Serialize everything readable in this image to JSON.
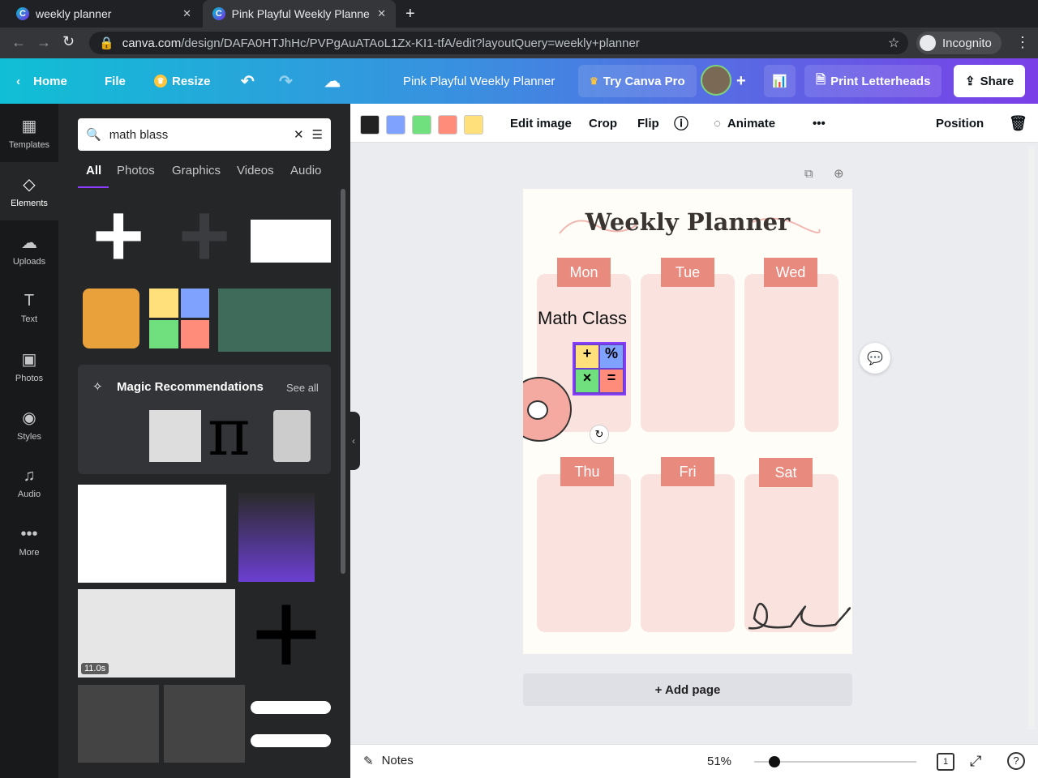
{
  "browser": {
    "tabs": [
      {
        "title": "weekly planner"
      },
      {
        "title": "Pink Playful Weekly Planne"
      }
    ],
    "url_host": "canva.com",
    "url_path": "/design/DAFA0HTJhHc/PVPgAuATAoL1Zx-KI1-tfA/edit?layoutQuery=weekly+planner",
    "profile": "Incognito"
  },
  "header": {
    "home": "Home",
    "file": "File",
    "resize": "Resize",
    "doc_title": "Pink Playful Weekly Planner",
    "try_pro": "Try Canva Pro",
    "print": "Print Letterheads",
    "share": "Share"
  },
  "rail": [
    {
      "label": "Templates"
    },
    {
      "label": "Elements"
    },
    {
      "label": "Uploads"
    },
    {
      "label": "Text"
    },
    {
      "label": "Photos"
    },
    {
      "label": "Styles"
    },
    {
      "label": "Audio"
    },
    {
      "label": "More"
    }
  ],
  "panel": {
    "search_value": "math blass",
    "tabs": [
      "All",
      "Photos",
      "Graphics",
      "Videos",
      "Audio"
    ],
    "magic_title": "Magic Recommendations",
    "see_all": "See all",
    "video_duration": "11.0s"
  },
  "toolbar": {
    "colors": [
      "#222222",
      "#7fa2ff",
      "#70e07e",
      "#ff8c7a",
      "#ffe07a"
    ],
    "edit_image": "Edit image",
    "crop": "Crop",
    "flip": "Flip",
    "animate": "Animate",
    "position": "Position"
  },
  "design": {
    "title": "Weekly Planner",
    "days": [
      "Mon",
      "Tue",
      "Wed",
      "Thu",
      "Fri",
      "Sat"
    ],
    "text_box": "Math Class"
  },
  "canvas": {
    "add_page": "+ Add page"
  },
  "bottom": {
    "notes": "Notes",
    "zoom": "51%",
    "zoom_value": 51,
    "page_count": "1"
  }
}
